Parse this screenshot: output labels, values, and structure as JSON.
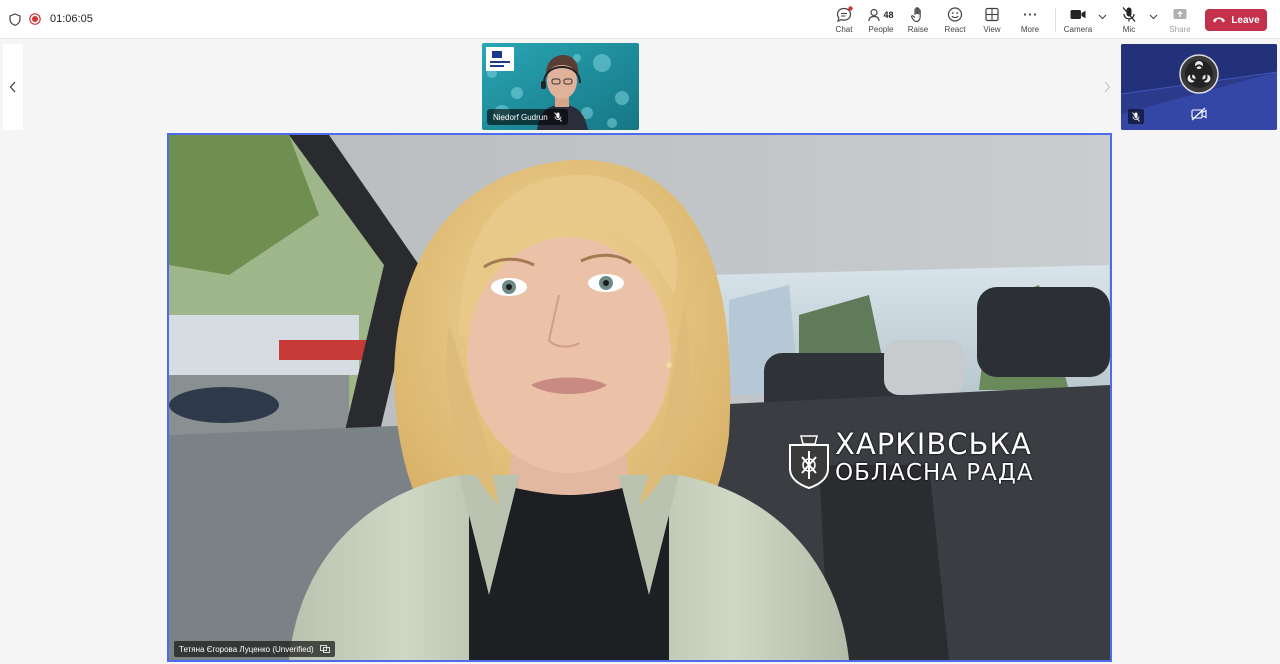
{
  "header": {
    "timer": "01:06:05"
  },
  "toolbar": {
    "chat_label": "Chat",
    "people_count": "48",
    "people_label": "People",
    "raise_label": "Raise",
    "react_label": "React",
    "view_label": "View",
    "more_label": "More",
    "camera_label": "Camera",
    "mic_label": "Mic",
    "share_label": "Share",
    "leave_label": "Leave"
  },
  "participants": {
    "thumb_name": "Niedorf Gudrun",
    "main_name": "Тетяна Єгорова Луценко (Unverified)"
  },
  "watermark": {
    "line1": "ХАРКІВСЬКА",
    "line2": "ОБЛАСНА РАДА"
  },
  "colors": {
    "accent": "#4f6bed",
    "leave": "#c4314b",
    "recording": "#d13438"
  }
}
